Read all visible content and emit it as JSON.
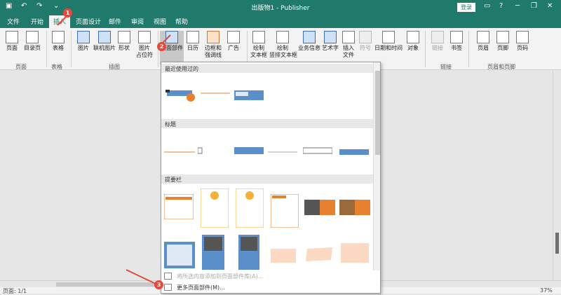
{
  "titlebar": {
    "title": "出版物1  -  Publisher",
    "login": "登录"
  },
  "tabs": [
    {
      "label": "文件"
    },
    {
      "label": "开始"
    },
    {
      "label": "插入"
    },
    {
      "label": "页面设计"
    },
    {
      "label": "邮件"
    },
    {
      "label": "审阅"
    },
    {
      "label": "视图"
    },
    {
      "label": "帮助"
    }
  ],
  "ribbon": {
    "buttons": [
      {
        "label": "页面"
      },
      {
        "label": "目录页"
      },
      {
        "label": "表格"
      },
      {
        "label": "图片"
      },
      {
        "label": "联机图片"
      },
      {
        "label": "形状"
      },
      {
        "label": "图片\n占位符"
      },
      {
        "label": "页面部件"
      },
      {
        "label": "日历"
      },
      {
        "label": "边框和\n强调线"
      },
      {
        "label": "广告"
      },
      {
        "label": "绘制\n文本框"
      },
      {
        "label": "绘制\n竖排文本框"
      },
      {
        "label": "业务信息"
      },
      {
        "label": "艺术字"
      },
      {
        "label": "插入\n文件"
      },
      {
        "label": "符号"
      },
      {
        "label": "日期和时间"
      },
      {
        "label": "对象"
      },
      {
        "label": "链接"
      },
      {
        "label": "书签"
      },
      {
        "label": "页眉"
      },
      {
        "label": "页脚"
      },
      {
        "label": "页码"
      }
    ],
    "groups": [
      {
        "label": "页面"
      },
      {
        "label": "表格"
      },
      {
        "label": "插图"
      },
      {
        "label": "链接"
      },
      {
        "label": "页眉和页脚"
      }
    ]
  },
  "gallery": {
    "sections": [
      {
        "label": "最近使用过的"
      },
      {
        "label": "标题"
      },
      {
        "label": "提要栏"
      }
    ],
    "footer": [
      {
        "label": "将所选内容添加到页面部件库(A)..."
      },
      {
        "label": "更多页面部件(M)..."
      }
    ]
  },
  "status": {
    "page": "页面: 1/1",
    "zoom": "37%"
  },
  "markers": [
    {
      "label": "1"
    },
    {
      "label": "2"
    },
    {
      "label": "3"
    }
  ],
  "colors": {
    "accent": "#1f7a6b",
    "marker": "#e8473c"
  }
}
